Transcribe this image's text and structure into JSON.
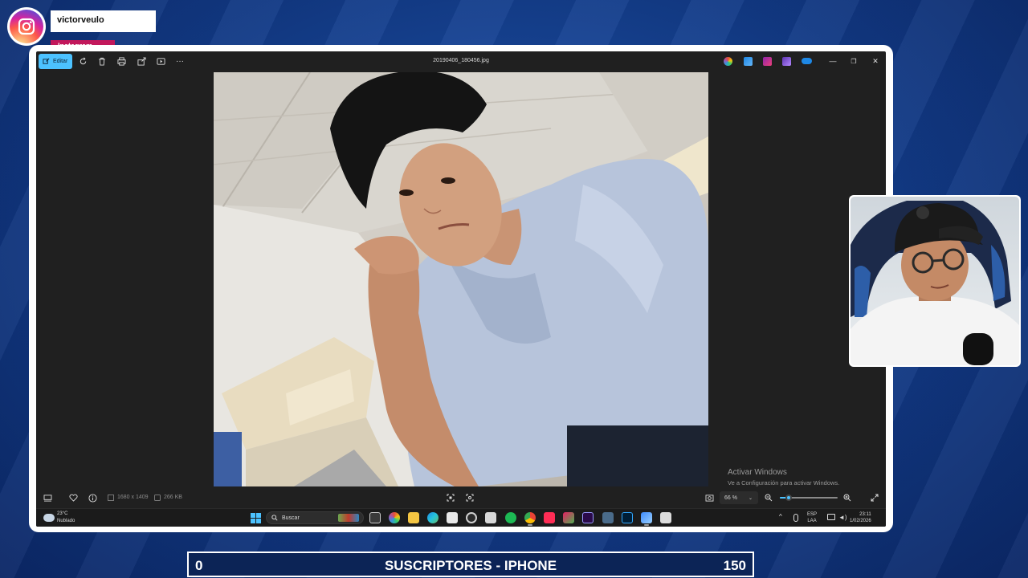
{
  "overlay": {
    "instagram_user": "victorveulo",
    "instagram_label": "Instagram"
  },
  "window": {
    "title": "20190406_180456.jpg",
    "edit_label": "Editar",
    "toolbar_icons": [
      "edit-icon",
      "rotate-icon",
      "delete-icon",
      "print-icon",
      "share-icon",
      "slideshow-icon",
      "more-icon"
    ],
    "app_icons": [
      "copilot-icon",
      "designer-icon",
      "clipchamp-icon",
      "photoshop-express-icon",
      "onedrive-icon"
    ],
    "controls": [
      "minimize",
      "restore",
      "close"
    ],
    "control_glyphs": {
      "minimize": "—",
      "restore": "❐",
      "close": "✕"
    }
  },
  "image_info": {
    "dimensions": "1680 x 1409",
    "size": "266 KB"
  },
  "viewer": {
    "zoom": "66 %",
    "zoom_level": 0.15
  },
  "activation": {
    "title": "Activar Windows",
    "subtitle": "Ve a Configuración para activar Windows."
  },
  "taskbar": {
    "weather_temp": "23°C",
    "weather_desc": "Nublado",
    "search_placeholder": "Buscar",
    "lang_top": "ESP",
    "lang_bottom": "LAA",
    "time": "23:11",
    "date": "1/02/2026",
    "apps": [
      "task-view",
      "copilot",
      "file-explorer",
      "edge",
      "store",
      "settings",
      "calendar",
      "spotify",
      "chrome",
      "tiktok",
      "app-switch",
      "premiere",
      "terminal",
      "photoshop",
      "photos",
      "snipping-tool"
    ]
  },
  "subscribers_bar": {
    "left": "0",
    "center": "SUSCRIPTORES - IPHONE",
    "right": "150"
  },
  "colors": {
    "accent": "#4cc2ff",
    "window_bg": "#202020",
    "page_bg": "#123a86",
    "instagram_pink": "#c2185b"
  }
}
